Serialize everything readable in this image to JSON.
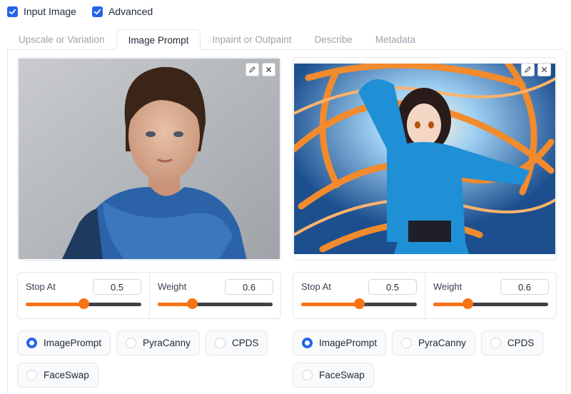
{
  "options": {
    "input_image": {
      "label": "Input Image",
      "checked": true
    },
    "advanced": {
      "label": "Advanced",
      "checked": true
    }
  },
  "tabs": [
    {
      "label": "Upscale or Variation",
      "active": false
    },
    {
      "label": "Image Prompt",
      "active": true
    },
    {
      "label": "Inpaint or Outpaint",
      "active": false
    },
    {
      "label": "Describe",
      "active": false
    },
    {
      "label": "Metadata",
      "active": false
    }
  ],
  "prompts": [
    {
      "stop_at": {
        "label": "Stop At",
        "value": "0.5",
        "fraction": 0.5
      },
      "weight": {
        "label": "Weight",
        "value": "0.6",
        "fraction": 0.3
      },
      "types": [
        "ImagePrompt",
        "PyraCanny",
        "CPDS",
        "FaceSwap"
      ],
      "selected": "ImagePrompt"
    },
    {
      "stop_at": {
        "label": "Stop At",
        "value": "0.5",
        "fraction": 0.5
      },
      "weight": {
        "label": "Weight",
        "value": "0.6",
        "fraction": 0.3
      },
      "types": [
        "ImagePrompt",
        "PyraCanny",
        "CPDS",
        "FaceSwap"
      ],
      "selected": "ImagePrompt"
    }
  ],
  "icons": {
    "edit": "pencil-icon",
    "clear": "close-icon",
    "check": "checkmark-icon"
  },
  "colors": {
    "accent": "#f97316",
    "checkbox": "#2563eb",
    "track": "#3f3f46"
  }
}
